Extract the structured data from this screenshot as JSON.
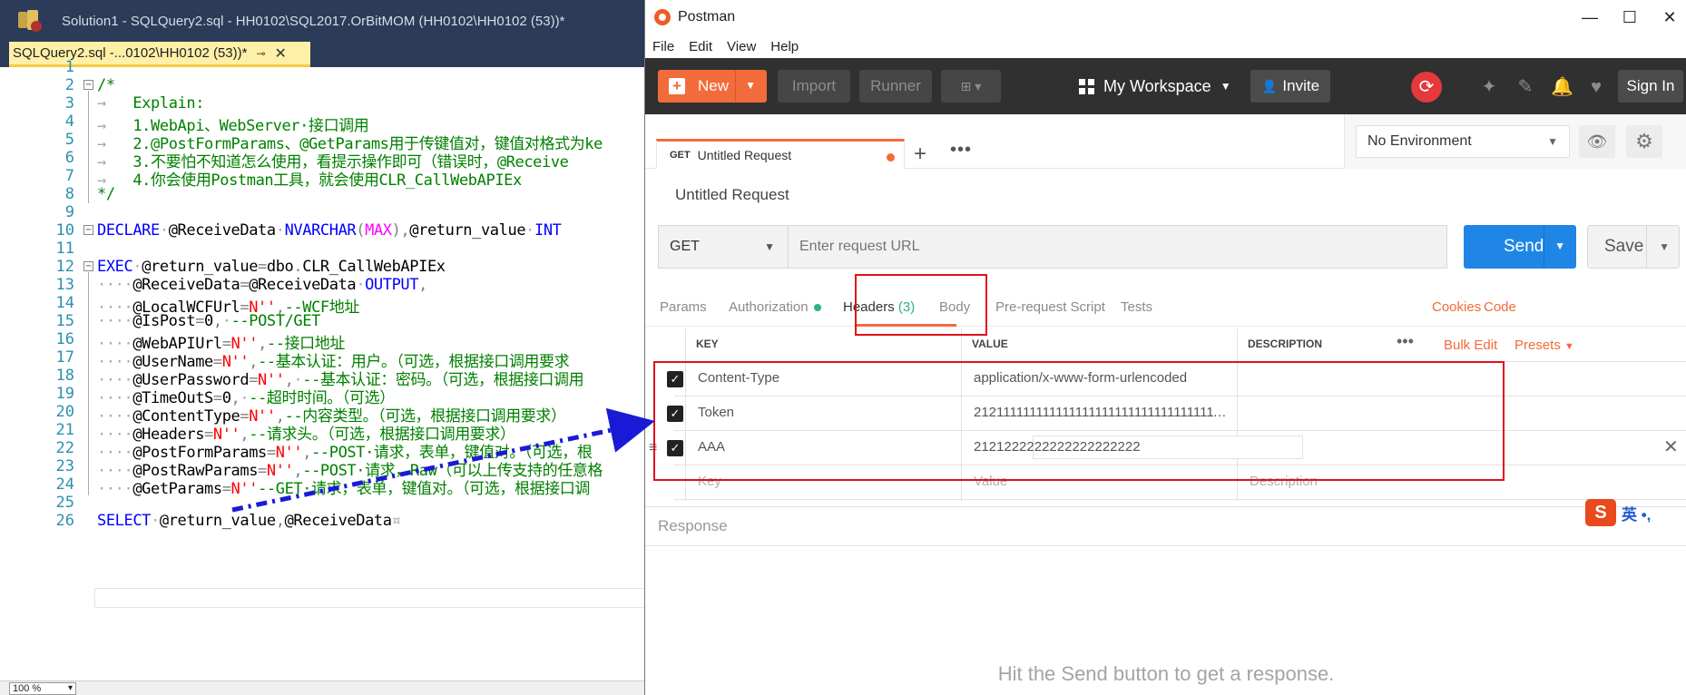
{
  "ssms": {
    "window_title": "Solution1 - SQLQuery2.sql - HH0102\\SQL2017.OrBitMOM (HH0102\\HH0102 (53))*",
    "tab_label": "SQLQuery2.sql -...0102\\HH0102 (53))*",
    "tab_pin": "⊸",
    "tab_close": "✕",
    "zoom": "100 %",
    "line_numbers": [
      "1",
      "2",
      "3",
      "4",
      "5",
      "6",
      "7",
      "8",
      "9",
      "10",
      "11",
      "12",
      "13",
      "14",
      "15",
      "16",
      "17",
      "18",
      "19",
      "20",
      "21",
      "22",
      "23",
      "24",
      "25",
      "26"
    ]
  },
  "postman": {
    "window_title": "Postman",
    "menu": [
      "File",
      "Edit",
      "View",
      "Help"
    ],
    "toolbar": {
      "new_label": "New",
      "import_label": "Import",
      "runner_label": "Runner",
      "workspace_label": "My Workspace",
      "invite_label": "Invite",
      "signin_label": "Sign In"
    },
    "request_tab": {
      "method": "GET",
      "title": "Untitled Request"
    },
    "environment": "No Environment",
    "request_name": "Untitled Request",
    "method": "GET",
    "url_placeholder": "Enter request URL",
    "send_label": "Send",
    "save_label": "Save",
    "sub_tabs": {
      "params": "Params",
      "authorization": "Authorization",
      "headers": "Headers",
      "headers_count": "(3)",
      "body": "Body",
      "prerequest": "Pre-request Script",
      "tests": "Tests",
      "cookies": "Cookies",
      "code": "Code"
    },
    "headers_table": {
      "col_key": "KEY",
      "col_value": "VALUE",
      "col_description": "DESCRIPTION",
      "bulk_edit": "Bulk Edit",
      "presets": "Presets",
      "rows": [
        {
          "key": "Content-Type",
          "value": "application/x-www-form-urlencoded",
          "checked": true
        },
        {
          "key": "Token",
          "value": "2121111111111111111111111111111111111111111111",
          "checked": true
        },
        {
          "key": "AAA",
          "value": "2121222222222222222222",
          "checked": true
        }
      ],
      "placeholder_key": "Key",
      "placeholder_value": "Value",
      "placeholder_description": "Description"
    },
    "response_label": "Response",
    "hint": "Hit the Send button to get a response.",
    "ime_label": "英 •,",
    "colors": {
      "accent": "#f26b3a",
      "send": "#1f86e6",
      "toolbar": "#303030",
      "annotation": "#e0101a"
    }
  }
}
